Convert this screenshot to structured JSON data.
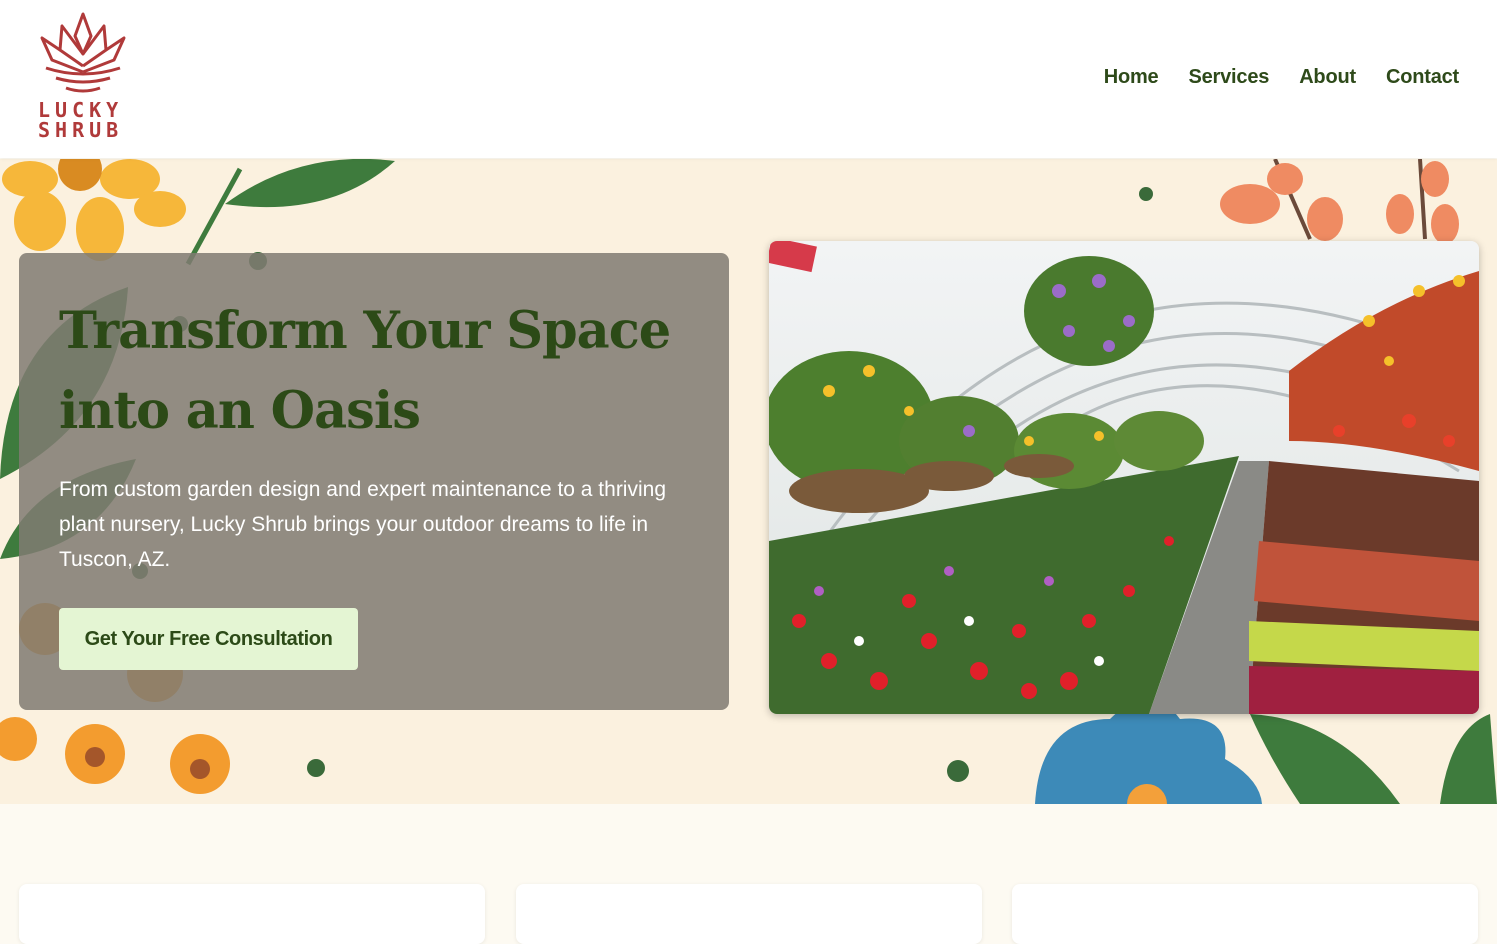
{
  "brand": {
    "logo_line1": "LUCKY",
    "logo_line2": "SHRUB",
    "logo_icon": "lotus-plant-icon",
    "logo_color": "#b03a3a"
  },
  "nav": {
    "items": [
      {
        "label": "Home"
      },
      {
        "label": "Services"
      },
      {
        "label": "About"
      },
      {
        "label": "Contact"
      }
    ]
  },
  "hero": {
    "title": "Transform Your Space into an Oasis",
    "description": "From custom garden design and expert maintenance to a thriving plant nursery, Lucky Shrub brings your outdoor dreams to life in Tuscon, AZ.",
    "cta_label": "Get Your Free Consultation",
    "photo_subject": "greenhouse-flowers-photo"
  },
  "colors": {
    "accent_green": "#2c4a17",
    "cta_bg": "#e4f5d3",
    "hero_bg": "#fbf1df"
  }
}
